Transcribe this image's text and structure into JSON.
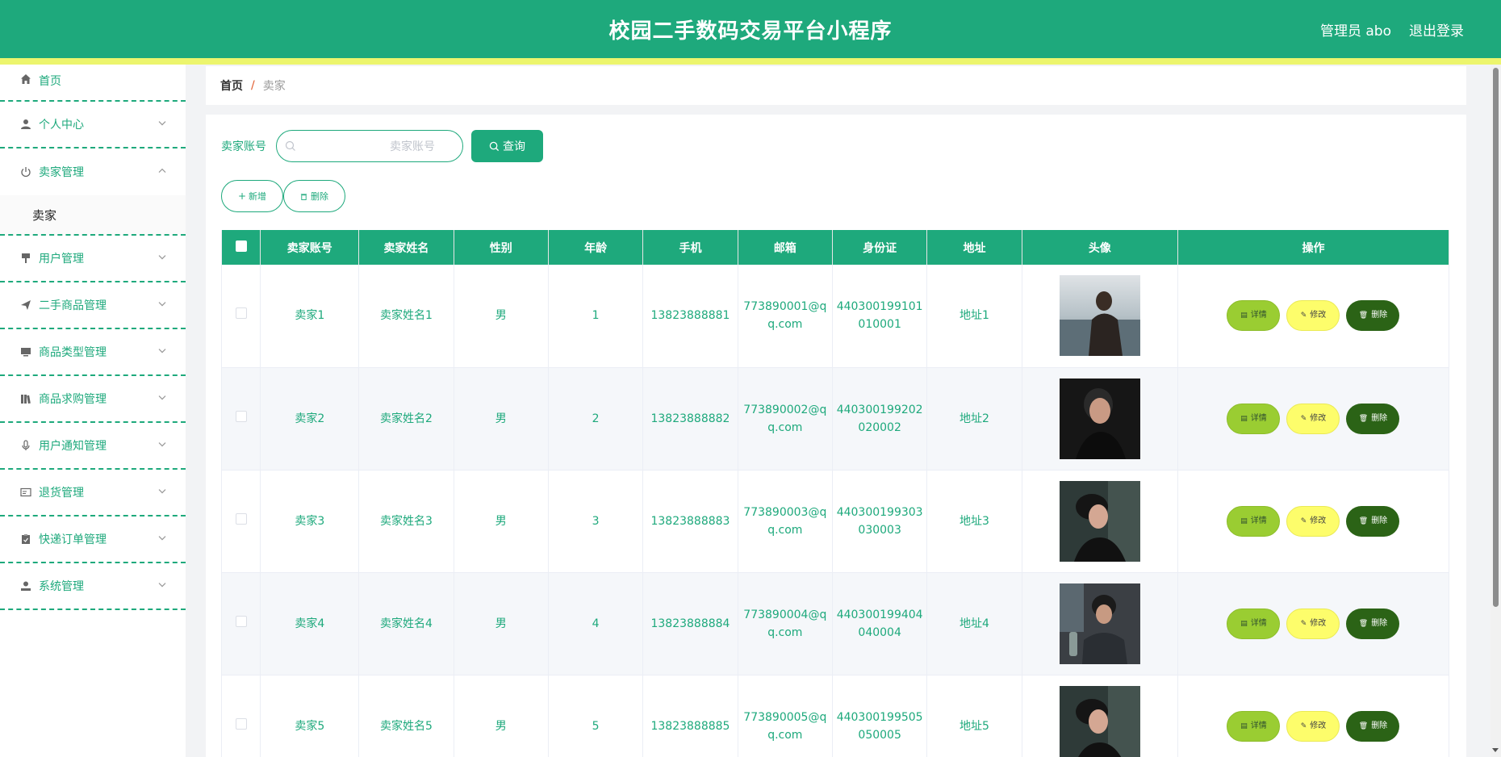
{
  "header": {
    "title": "校园二手数码交易平台小程序",
    "user": "管理员 abo",
    "logout": "退出登录"
  },
  "sidebar": {
    "items": [
      {
        "label": "首页",
        "icon": "home-icon"
      },
      {
        "label": "个人中心",
        "icon": "user-icon"
      },
      {
        "label": "卖家管理",
        "icon": "power-icon",
        "expanded": true
      },
      {
        "label": "用户管理",
        "icon": "brush-icon"
      },
      {
        "label": "二手商品管理",
        "icon": "send-icon"
      },
      {
        "label": "商品类型管理",
        "icon": "monitor-icon"
      },
      {
        "label": "商品求购管理",
        "icon": "books-icon"
      },
      {
        "label": "用户通知管理",
        "icon": "microphone-icon"
      },
      {
        "label": "退货管理",
        "icon": "postcard-icon"
      },
      {
        "label": "快递订单管理",
        "icon": "clipboard-icon"
      },
      {
        "label": "系统管理",
        "icon": "user-solid-icon"
      }
    ],
    "sub_item": "卖家"
  },
  "breadcrumb": {
    "home": "首页",
    "separator": "/",
    "current": "卖家"
  },
  "search": {
    "label": "卖家账号",
    "placeholder": "卖家账号",
    "button": "查询"
  },
  "actions": {
    "add": "新增",
    "delete": "删除"
  },
  "table": {
    "headers": [
      "卖家账号",
      "卖家姓名",
      "性别",
      "年龄",
      "手机",
      "邮箱",
      "身份证",
      "地址",
      "头像",
      "操作"
    ],
    "rows": [
      {
        "account": "卖家1",
        "name": "卖家姓名1",
        "gender": "男",
        "age": "1",
        "phone": "13823888881",
        "email_1": "773890001@q",
        "email_2": "q.com",
        "id_1": "440300199101",
        "id_2": "010001",
        "address": "地址1"
      },
      {
        "account": "卖家2",
        "name": "卖家姓名2",
        "gender": "男",
        "age": "2",
        "phone": "13823888882",
        "email_1": "773890002@q",
        "email_2": "q.com",
        "id_1": "440300199202",
        "id_2": "020002",
        "address": "地址2"
      },
      {
        "account": "卖家3",
        "name": "卖家姓名3",
        "gender": "男",
        "age": "3",
        "phone": "13823888883",
        "email_1": "773890003@q",
        "email_2": "q.com",
        "id_1": "440300199303",
        "id_2": "030003",
        "address": "地址3"
      },
      {
        "account": "卖家4",
        "name": "卖家姓名4",
        "gender": "男",
        "age": "4",
        "phone": "13823888884",
        "email_1": "773890004@q",
        "email_2": "q.com",
        "id_1": "440300199404",
        "id_2": "040004",
        "address": "地址4"
      },
      {
        "account": "卖家5",
        "name": "卖家姓名5",
        "gender": "男",
        "age": "5",
        "phone": "13823888885",
        "email_1": "773890005@q",
        "email_2": "q.com",
        "id_1": "440300199505",
        "id_2": "050005",
        "address": "地址5"
      }
    ],
    "op_labels": {
      "detail": "详情",
      "edit": "修改",
      "delete": "删除"
    }
  },
  "colors": {
    "primary": "#1ea97c",
    "accent_strip": "#ecf56d",
    "detail_btn": "#9acd32",
    "edit_btn": "#fdfd6b",
    "delete_btn": "#2b6316"
  }
}
